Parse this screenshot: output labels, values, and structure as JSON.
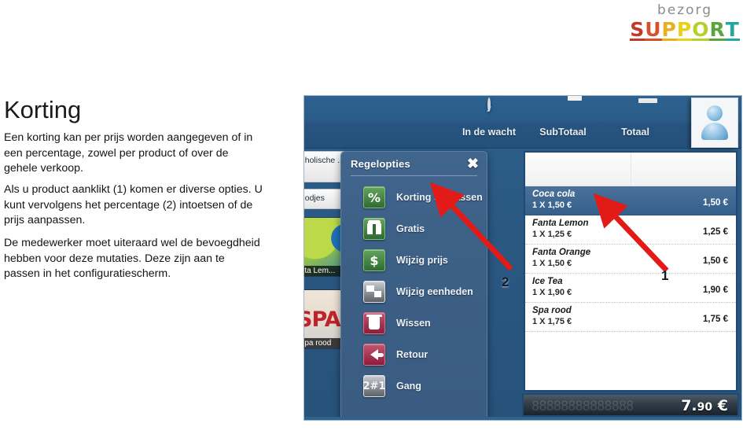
{
  "logo": {
    "top_word": "bezorg",
    "letters": [
      {
        "char": "S",
        "color": "#c0392b"
      },
      {
        "char": "U",
        "color": "#d94f2a"
      },
      {
        "char": "P",
        "color": "#e8b020"
      },
      {
        "char": "P",
        "color": "#e8d11a"
      },
      {
        "char": "O",
        "color": "#b7cf2a"
      },
      {
        "char": "R",
        "color": "#5aa63c"
      },
      {
        "char": "T",
        "color": "#23a7a0"
      }
    ]
  },
  "article": {
    "title": "Korting",
    "paragraphs": [
      "Een korting kan per prijs worden aangegeven of in een percentage, zowel per product of over de gehele verkoop.",
      "Als u product aanklikt (1) komen er diverse opties. U kunt vervolgens het percentage (2) intoetsen of de prijs aanpassen.",
      "De medewerker moet uiteraard wel de bevoegdheid hebben voor deze mutaties. Deze zijn aan te passen in het configuratiescherm."
    ]
  },
  "pos": {
    "toolbar": [
      {
        "label": "In de wacht",
        "icon": "clock-icon"
      },
      {
        "label": "SubTotaal",
        "icon": "printer-icon"
      },
      {
        "label": "Totaal",
        "icon": "cash-drawer-icon"
      }
    ],
    "user_avatar_icon": "user-avatar-icon",
    "categories": [
      {
        "label": "...holische ...ken"
      },
      {
        "label": "...odjes"
      }
    ],
    "product_tiles": [
      {
        "label": "...ta Lem..."
      },
      {
        "label": "...pa rood",
        "brand": "SPA"
      }
    ],
    "dialog": {
      "title": "Regelopties",
      "close_label": "✖",
      "items": [
        {
          "label": "Korting toepassen",
          "icon": "percent-icon",
          "style": "green",
          "glyph": "%"
        },
        {
          "label": "Gratis",
          "icon": "gift-icon",
          "style": "green",
          "glyph": ""
        },
        {
          "label": "Wijzig prijs",
          "icon": "dollar-icon",
          "style": "green",
          "glyph": "$"
        },
        {
          "label": "Wijzig eenheden",
          "icon": "units-icon",
          "style": "grey",
          "glyph": ""
        },
        {
          "label": "Wissen",
          "icon": "trash-icon",
          "style": "red",
          "glyph": ""
        },
        {
          "label": "Retour",
          "icon": "undo-arrow-icon",
          "style": "red",
          "glyph": ""
        },
        {
          "label": "Gang",
          "icon": "course-number-icon",
          "style": "grey-small",
          "glyph": "2#1"
        }
      ]
    },
    "order_lines": [
      {
        "name": "Coca cola",
        "qty": "1 X  1,50 €",
        "amount": "1,50 €",
        "selected": true
      },
      {
        "name": "Fanta Lemon",
        "qty": "1 X 1,25 €",
        "amount": "1,25 €",
        "selected": false
      },
      {
        "name": "Fanta Orange",
        "qty": "1 X 1,50 €",
        "amount": "1,50 €",
        "selected": false
      },
      {
        "name": "Ice Tea",
        "qty": "1 X 1,90 €",
        "amount": "1,90 €",
        "selected": false
      },
      {
        "name": "Spa rood",
        "qty": "1 X 1,75 €",
        "amount": "1,75 €",
        "selected": false
      }
    ],
    "total": {
      "whole": "7.",
      "decimals": "90",
      "currency": "€",
      "ghost_text": "88888888888888"
    }
  },
  "annotations": [
    {
      "number": "1",
      "target": "Coca cola order line"
    },
    {
      "number": "2",
      "target": "Korting toepassen menu item"
    }
  ],
  "colors": {
    "pos_blue": "#2b5a86",
    "selected_row": "#35608c",
    "arrow_red": "#e21b18",
    "accent_green": "#2f6b33",
    "accent_red": "#8c1c3b"
  }
}
